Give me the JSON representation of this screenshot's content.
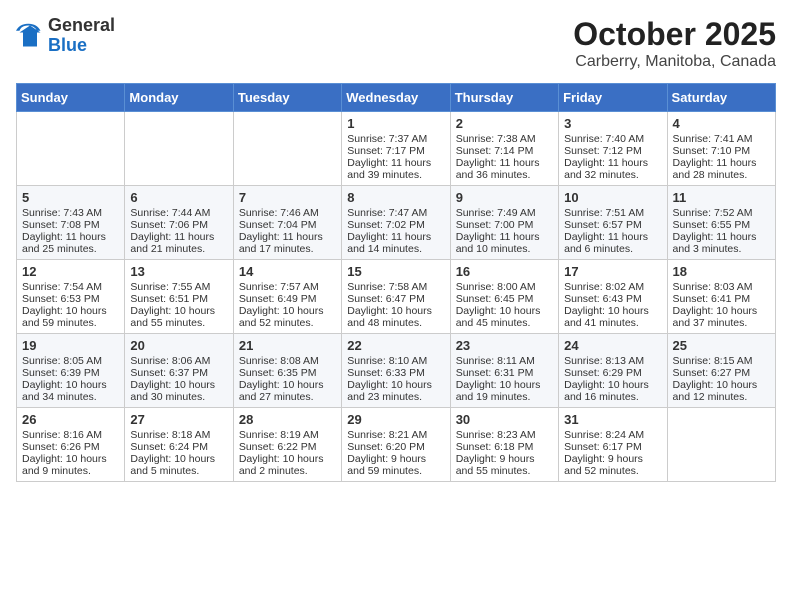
{
  "header": {
    "logo_general": "General",
    "logo_blue": "Blue",
    "month_title": "October 2025",
    "location": "Carberry, Manitoba, Canada"
  },
  "days_of_week": [
    "Sunday",
    "Monday",
    "Tuesday",
    "Wednesday",
    "Thursday",
    "Friday",
    "Saturday"
  ],
  "weeks": [
    [
      {
        "day": "",
        "sunrise": "",
        "sunset": "",
        "daylight": ""
      },
      {
        "day": "",
        "sunrise": "",
        "sunset": "",
        "daylight": ""
      },
      {
        "day": "",
        "sunrise": "",
        "sunset": "",
        "daylight": ""
      },
      {
        "day": "1",
        "sunrise": "Sunrise: 7:37 AM",
        "sunset": "Sunset: 7:17 PM",
        "daylight": "Daylight: 11 hours and 39 minutes."
      },
      {
        "day": "2",
        "sunrise": "Sunrise: 7:38 AM",
        "sunset": "Sunset: 7:14 PM",
        "daylight": "Daylight: 11 hours and 36 minutes."
      },
      {
        "day": "3",
        "sunrise": "Sunrise: 7:40 AM",
        "sunset": "Sunset: 7:12 PM",
        "daylight": "Daylight: 11 hours and 32 minutes."
      },
      {
        "day": "4",
        "sunrise": "Sunrise: 7:41 AM",
        "sunset": "Sunset: 7:10 PM",
        "daylight": "Daylight: 11 hours and 28 minutes."
      }
    ],
    [
      {
        "day": "5",
        "sunrise": "Sunrise: 7:43 AM",
        "sunset": "Sunset: 7:08 PM",
        "daylight": "Daylight: 11 hours and 25 minutes."
      },
      {
        "day": "6",
        "sunrise": "Sunrise: 7:44 AM",
        "sunset": "Sunset: 7:06 PM",
        "daylight": "Daylight: 11 hours and 21 minutes."
      },
      {
        "day": "7",
        "sunrise": "Sunrise: 7:46 AM",
        "sunset": "Sunset: 7:04 PM",
        "daylight": "Daylight: 11 hours and 17 minutes."
      },
      {
        "day": "8",
        "sunrise": "Sunrise: 7:47 AM",
        "sunset": "Sunset: 7:02 PM",
        "daylight": "Daylight: 11 hours and 14 minutes."
      },
      {
        "day": "9",
        "sunrise": "Sunrise: 7:49 AM",
        "sunset": "Sunset: 7:00 PM",
        "daylight": "Daylight: 11 hours and 10 minutes."
      },
      {
        "day": "10",
        "sunrise": "Sunrise: 7:51 AM",
        "sunset": "Sunset: 6:57 PM",
        "daylight": "Daylight: 11 hours and 6 minutes."
      },
      {
        "day": "11",
        "sunrise": "Sunrise: 7:52 AM",
        "sunset": "Sunset: 6:55 PM",
        "daylight": "Daylight: 11 hours and 3 minutes."
      }
    ],
    [
      {
        "day": "12",
        "sunrise": "Sunrise: 7:54 AM",
        "sunset": "Sunset: 6:53 PM",
        "daylight": "Daylight: 10 hours and 59 minutes."
      },
      {
        "day": "13",
        "sunrise": "Sunrise: 7:55 AM",
        "sunset": "Sunset: 6:51 PM",
        "daylight": "Daylight: 10 hours and 55 minutes."
      },
      {
        "day": "14",
        "sunrise": "Sunrise: 7:57 AM",
        "sunset": "Sunset: 6:49 PM",
        "daylight": "Daylight: 10 hours and 52 minutes."
      },
      {
        "day": "15",
        "sunrise": "Sunrise: 7:58 AM",
        "sunset": "Sunset: 6:47 PM",
        "daylight": "Daylight: 10 hours and 48 minutes."
      },
      {
        "day": "16",
        "sunrise": "Sunrise: 8:00 AM",
        "sunset": "Sunset: 6:45 PM",
        "daylight": "Daylight: 10 hours and 45 minutes."
      },
      {
        "day": "17",
        "sunrise": "Sunrise: 8:02 AM",
        "sunset": "Sunset: 6:43 PM",
        "daylight": "Daylight: 10 hours and 41 minutes."
      },
      {
        "day": "18",
        "sunrise": "Sunrise: 8:03 AM",
        "sunset": "Sunset: 6:41 PM",
        "daylight": "Daylight: 10 hours and 37 minutes."
      }
    ],
    [
      {
        "day": "19",
        "sunrise": "Sunrise: 8:05 AM",
        "sunset": "Sunset: 6:39 PM",
        "daylight": "Daylight: 10 hours and 34 minutes."
      },
      {
        "day": "20",
        "sunrise": "Sunrise: 8:06 AM",
        "sunset": "Sunset: 6:37 PM",
        "daylight": "Daylight: 10 hours and 30 minutes."
      },
      {
        "day": "21",
        "sunrise": "Sunrise: 8:08 AM",
        "sunset": "Sunset: 6:35 PM",
        "daylight": "Daylight: 10 hours and 27 minutes."
      },
      {
        "day": "22",
        "sunrise": "Sunrise: 8:10 AM",
        "sunset": "Sunset: 6:33 PM",
        "daylight": "Daylight: 10 hours and 23 minutes."
      },
      {
        "day": "23",
        "sunrise": "Sunrise: 8:11 AM",
        "sunset": "Sunset: 6:31 PM",
        "daylight": "Daylight: 10 hours and 19 minutes."
      },
      {
        "day": "24",
        "sunrise": "Sunrise: 8:13 AM",
        "sunset": "Sunset: 6:29 PM",
        "daylight": "Daylight: 10 hours and 16 minutes."
      },
      {
        "day": "25",
        "sunrise": "Sunrise: 8:15 AM",
        "sunset": "Sunset: 6:27 PM",
        "daylight": "Daylight: 10 hours and 12 minutes."
      }
    ],
    [
      {
        "day": "26",
        "sunrise": "Sunrise: 8:16 AM",
        "sunset": "Sunset: 6:26 PM",
        "daylight": "Daylight: 10 hours and 9 minutes."
      },
      {
        "day": "27",
        "sunrise": "Sunrise: 8:18 AM",
        "sunset": "Sunset: 6:24 PM",
        "daylight": "Daylight: 10 hours and 5 minutes."
      },
      {
        "day": "28",
        "sunrise": "Sunrise: 8:19 AM",
        "sunset": "Sunset: 6:22 PM",
        "daylight": "Daylight: 10 hours and 2 minutes."
      },
      {
        "day": "29",
        "sunrise": "Sunrise: 8:21 AM",
        "sunset": "Sunset: 6:20 PM",
        "daylight": "Daylight: 9 hours and 59 minutes."
      },
      {
        "day": "30",
        "sunrise": "Sunrise: 8:23 AM",
        "sunset": "Sunset: 6:18 PM",
        "daylight": "Daylight: 9 hours and 55 minutes."
      },
      {
        "day": "31",
        "sunrise": "Sunrise: 8:24 AM",
        "sunset": "Sunset: 6:17 PM",
        "daylight": "Daylight: 9 hours and 52 minutes."
      },
      {
        "day": "",
        "sunrise": "",
        "sunset": "",
        "daylight": ""
      }
    ]
  ]
}
